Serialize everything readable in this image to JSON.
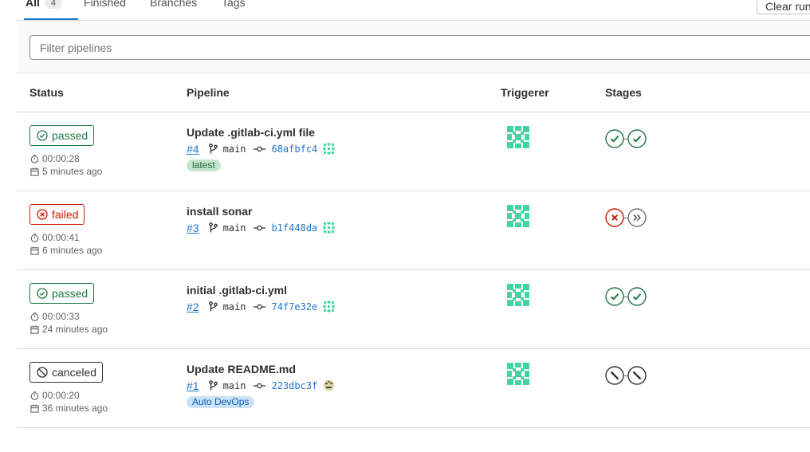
{
  "tabs": [
    {
      "label": "All",
      "count": "4"
    },
    {
      "label": "Finished"
    },
    {
      "label": "Branches"
    },
    {
      "label": "Tags"
    }
  ],
  "clear_button_label": "Clear runne",
  "filter": {
    "placeholder": "Filter pipelines"
  },
  "columns": {
    "status": "Status",
    "pipeline": "Pipeline",
    "triggerer": "Triggerer",
    "stages": "Stages"
  },
  "pipelines": [
    {
      "status": "passed",
      "duration": "00:00:28",
      "finished": "5 minutes ago",
      "title": "Update .gitlab-ci.yml file",
      "id": "#4",
      "branch": "main",
      "sha": "68afbfc4",
      "tag": "latest",
      "stages": [
        "success",
        "success"
      ]
    },
    {
      "status": "failed",
      "duration": "00:00:41",
      "finished": "6 minutes ago",
      "title": "install sonar",
      "id": "#3",
      "branch": "main",
      "sha": "b1f448da",
      "tag": "",
      "stages": [
        "failed",
        "skipped"
      ]
    },
    {
      "status": "passed",
      "duration": "00:00:33",
      "finished": "24 minutes ago",
      "title": "initial .gitlab-ci.yml",
      "id": "#2",
      "branch": "main",
      "sha": "74f7e32e",
      "tag": "",
      "stages": [
        "success",
        "success"
      ]
    },
    {
      "status": "canceled",
      "duration": "00:00:20",
      "finished": "36 minutes ago",
      "title": "Update README.md",
      "id": "#1",
      "branch": "main",
      "sha": "223dbc3f",
      "tag": "Auto DevOps",
      "stages": [
        "canceled",
        "canceled"
      ]
    }
  ],
  "colors": {
    "success": "#217645",
    "failed": "#c91c00",
    "canceled": "#333238",
    "link": "#1f75cb",
    "avatar": "#3fd6a6"
  },
  "icons": {
    "status_passed": "check-circle-icon",
    "status_failed": "x-circle-icon",
    "status_canceled": "cancel-icon",
    "duration": "timer-icon",
    "finished": "calendar-icon",
    "branch": "branch-icon",
    "commit": "commit-icon"
  }
}
